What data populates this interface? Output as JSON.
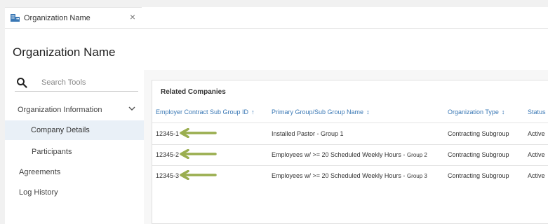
{
  "tab": {
    "label": "Organization Name",
    "close": "×"
  },
  "page": {
    "title": "Organization Name"
  },
  "search": {
    "placeholder": "Search Tools"
  },
  "sidebar": {
    "group": "Organization Information",
    "items": [
      {
        "label": "Company Details"
      },
      {
        "label": "Participants"
      },
      {
        "label": "Agreements"
      },
      {
        "label": "Log History"
      }
    ]
  },
  "panel": {
    "title": "Related Companies",
    "columns": [
      {
        "label": "Employer Contract Sub Group ID",
        "sort": "↑"
      },
      {
        "label": "Primary Group/Sub Group Name",
        "sort": "↕"
      },
      {
        "label": "Organization Type",
        "sort": "↕"
      },
      {
        "label": "Status"
      }
    ],
    "rows": [
      {
        "id": "12345-1",
        "name": "Installed Pastor - Group 1",
        "name_suffix": "",
        "type": "Contracting Subgroup",
        "status": "Active"
      },
      {
        "id": "12345-2",
        "name": "Employees w/ >= 20 Scheduled Weekly Hours - ",
        "name_suffix": "Group 2",
        "type": "Contracting Subgroup",
        "status": "Active"
      },
      {
        "id": "12345-3",
        "name": "Employees w/ >= 20 Scheduled Weekly Hours - ",
        "name_suffix": "Group 3",
        "type": "Contracting Subgroup",
        "status": "Active"
      }
    ]
  },
  "colors": {
    "link": "#3a78b5",
    "arrow": "#9aae4f",
    "active_bg": "#e9f0f7"
  },
  "icons": {
    "tab": "organization-icon",
    "search": "search-icon",
    "chevron": "chevron-down-icon",
    "arrow": "arrow-left-icon"
  }
}
